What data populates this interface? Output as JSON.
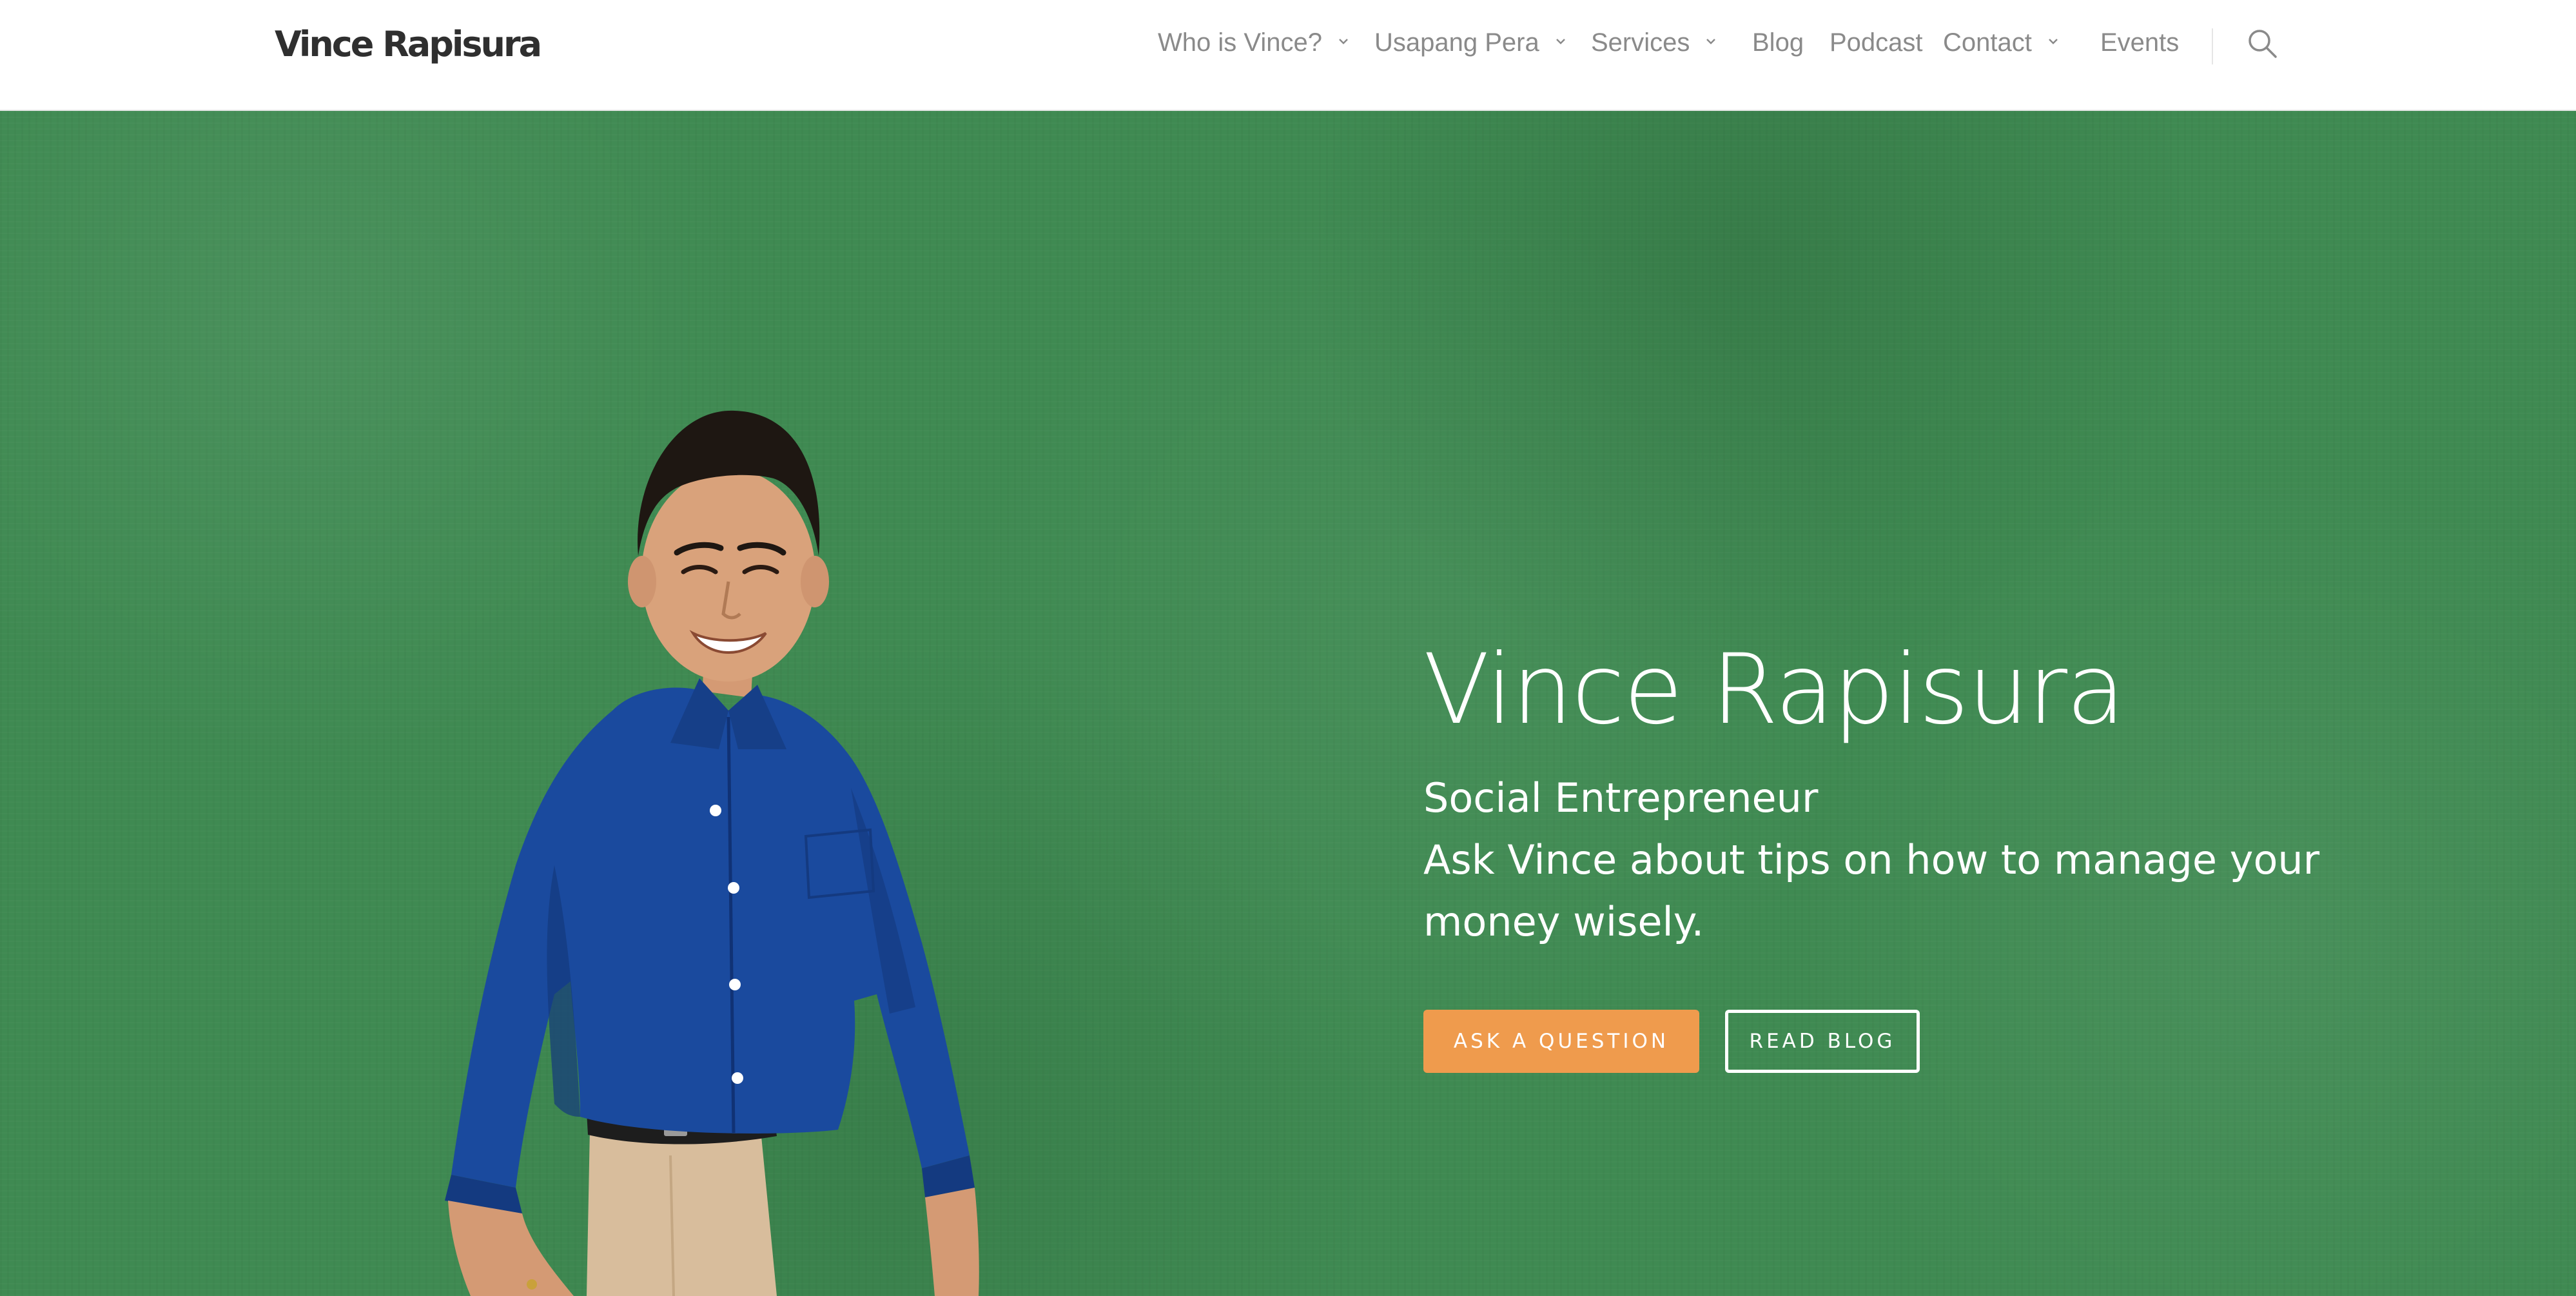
{
  "header": {
    "logo_text": "Vince Rapisura",
    "nav": [
      {
        "label": "Who is Vince?",
        "has_dropdown": true
      },
      {
        "label": "Usapang Pera",
        "has_dropdown": true
      },
      {
        "label": "Services",
        "has_dropdown": true
      },
      {
        "label": "Blog",
        "has_dropdown": false
      },
      {
        "label": "Podcast",
        "has_dropdown": false
      },
      {
        "label": "Contact",
        "has_dropdown": true
      },
      {
        "label": "Events",
        "has_dropdown": false
      }
    ],
    "search_icon": "search-icon"
  },
  "hero": {
    "title": "Vince Rapisura",
    "subtitle_line1": "Social Entrepreneur",
    "subtitle_line2": "Ask Vince about tips on how to manage your",
    "subtitle_line3": "money wisely.",
    "primary_button": "ASK A QUESTION",
    "secondary_button": "READ BLOG"
  },
  "colors": {
    "hero_background": "#3f8a52",
    "accent_button": "#ef9b4d",
    "nav_text": "#8a8a8a",
    "logo_text": "#2f2f2f",
    "shirt": "#1a4a9e"
  }
}
